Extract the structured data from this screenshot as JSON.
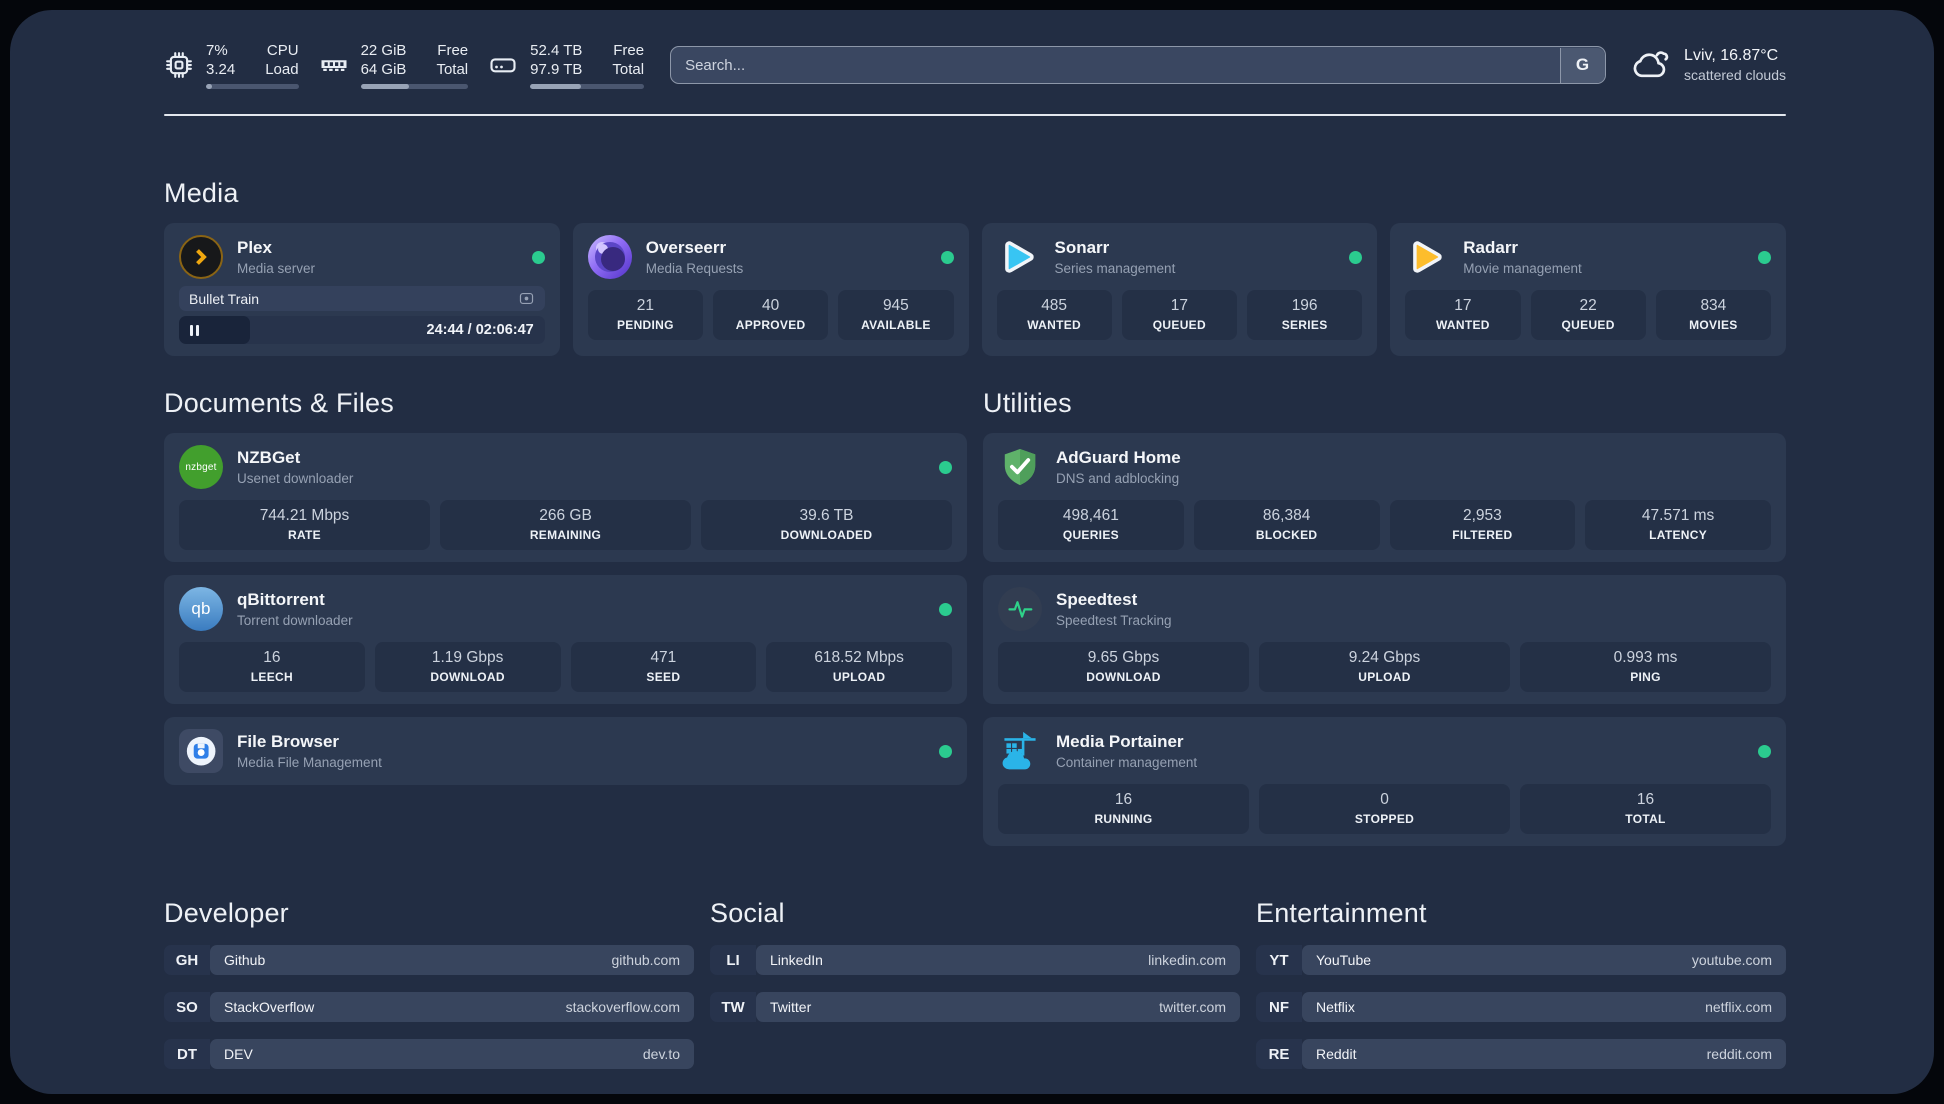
{
  "header": {
    "stats": [
      {
        "value_top": "7%",
        "value_bottom": "3.24",
        "label_top": "CPU",
        "label_bottom": "Load",
        "progress": "7%"
      },
      {
        "value_top": "22 GiB",
        "value_bottom": "64 GiB",
        "label_top": "Free",
        "label_bottom": "Total",
        "progress": "45%"
      },
      {
        "value_top": "52.4 TB",
        "value_bottom": "97.9 TB",
        "label_top": "Free",
        "label_bottom": "Total",
        "progress": "45%"
      }
    ],
    "search": {
      "placeholder": "Search...",
      "provider_button": "G"
    },
    "weather": {
      "location": "Lviv, 16.87°C",
      "condition": "scattered clouds"
    }
  },
  "media": {
    "heading": "Media",
    "plex": {
      "title": "Plex",
      "subtitle": "Media server",
      "status": "online",
      "now_playing": "Bullet Train",
      "time": "24:44 / 02:06:47",
      "progress": "19.5%"
    },
    "overseerr": {
      "title": "Overseerr",
      "subtitle": "Media Requests",
      "status": "online",
      "stats": [
        {
          "value": "21",
          "label": "PENDING"
        },
        {
          "value": "40",
          "label": "APPROVED"
        },
        {
          "value": "945",
          "label": "AVAILABLE"
        }
      ]
    },
    "sonarr": {
      "title": "Sonarr",
      "subtitle": "Series management",
      "status": "online",
      "stats": [
        {
          "value": "485",
          "label": "WANTED"
        },
        {
          "value": "17",
          "label": "QUEUED"
        },
        {
          "value": "196",
          "label": "SERIES"
        }
      ]
    },
    "radarr": {
      "title": "Radarr",
      "subtitle": "Movie management",
      "status": "online",
      "stats": [
        {
          "value": "17",
          "label": "WANTED"
        },
        {
          "value": "22",
          "label": "QUEUED"
        },
        {
          "value": "834",
          "label": "MOVIES"
        }
      ]
    }
  },
  "documents": {
    "heading": "Documents & Files",
    "nzbget": {
      "title": "NZBGet",
      "subtitle": "Usenet downloader",
      "icon_text": "nzbget",
      "status": "online",
      "stats": [
        {
          "value": "744.21 Mbps",
          "label": "RATE"
        },
        {
          "value": "266 GB",
          "label": "REMAINING"
        },
        {
          "value": "39.6 TB",
          "label": "DOWNLOADED"
        }
      ]
    },
    "qbittorrent": {
      "title": "qBittorrent",
      "subtitle": "Torrent downloader",
      "icon_text": "qb",
      "status": "online",
      "stats": [
        {
          "value": "16",
          "label": "LEECH"
        },
        {
          "value": "1.19 Gbps",
          "label": "DOWNLOAD"
        },
        {
          "value": "471",
          "label": "SEED"
        },
        {
          "value": "618.52 Mbps",
          "label": "UPLOAD"
        }
      ]
    },
    "filebrowser": {
      "title": "File Browser",
      "subtitle": "Media File Management",
      "status": "online"
    }
  },
  "utilities": {
    "heading": "Utilities",
    "adguard": {
      "title": "AdGuard Home",
      "subtitle": "DNS and adblocking",
      "stats": [
        {
          "value": "498,461",
          "label": "QUERIES"
        },
        {
          "value": "86,384",
          "label": "BLOCKED"
        },
        {
          "value": "2,953",
          "label": "FILTERED"
        },
        {
          "value": "47.571 ms",
          "label": "LATENCY"
        }
      ]
    },
    "speedtest": {
      "title": "Speedtest",
      "subtitle": "Speedtest Tracking",
      "stats": [
        {
          "value": "9.65 Gbps",
          "label": "DOWNLOAD"
        },
        {
          "value": "9.24 Gbps",
          "label": "UPLOAD"
        },
        {
          "value": "0.993 ms",
          "label": "PING"
        }
      ]
    },
    "portainer": {
      "title": "Media Portainer",
      "subtitle": "Container management",
      "status": "online",
      "stats": [
        {
          "value": "16",
          "label": "RUNNING"
        },
        {
          "value": "0",
          "label": "STOPPED"
        },
        {
          "value": "16",
          "label": "TOTAL"
        }
      ]
    }
  },
  "links": {
    "developer": {
      "heading": "Developer",
      "items": [
        {
          "abbr": "GH",
          "name": "Github",
          "url": "github.com"
        },
        {
          "abbr": "SO",
          "name": "StackOverflow",
          "url": "stackoverflow.com"
        },
        {
          "abbr": "DT",
          "name": "DEV",
          "url": "dev.to"
        }
      ]
    },
    "social": {
      "heading": "Social",
      "items": [
        {
          "abbr": "LI",
          "name": "LinkedIn",
          "url": "linkedin.com"
        },
        {
          "abbr": "TW",
          "name": "Twitter",
          "url": "twitter.com"
        }
      ]
    },
    "entertainment": {
      "heading": "Entertainment",
      "items": [
        {
          "abbr": "YT",
          "name": "YouTube",
          "url": "youtube.com"
        },
        {
          "abbr": "NF",
          "name": "Netflix",
          "url": "netflix.com"
        },
        {
          "abbr": "RE",
          "name": "Reddit",
          "url": "reddit.com"
        }
      ]
    }
  },
  "colors": {
    "status_online": "#2bcb8f",
    "plex": "#efa70f",
    "overseerr": "#7b5bea",
    "sonarr": "#38c5f3",
    "radarr": "#fdbd2c",
    "nzbget": "#429f2d",
    "qbittorrent": "#468fd5",
    "adguard": "#5fb26a",
    "speedtest": "#2fd189",
    "portainer": "#2ab4e8",
    "filebrowser": "#2f7fe8"
  }
}
